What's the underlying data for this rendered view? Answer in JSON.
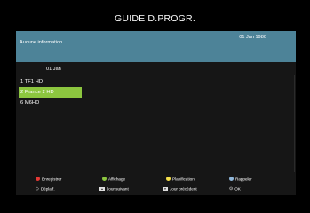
{
  "screen": {
    "title": "GUIDE D.PROGR."
  },
  "info_bar": {
    "message": "Aucune information",
    "date": "01 Jan 1980"
  },
  "guide": {
    "date": "01 Jan",
    "channels": [
      {
        "label": "1 TF1 HD",
        "selected": false
      },
      {
        "label": "2 France 2 HD",
        "selected": true
      },
      {
        "label": "6 M6HD",
        "selected": false
      }
    ]
  },
  "legend": {
    "row1": [
      {
        "label": "Enregistrer",
        "icon": "red-button-icon",
        "color": "#e53935"
      },
      {
        "label": "Affichage",
        "icon": "green-button-icon",
        "color": "#8cc63f"
      },
      {
        "label": "Planification",
        "icon": "yellow-button-icon",
        "color": "#f6e04b"
      },
      {
        "label": "Rappeler",
        "icon": "blue-button-icon",
        "color": "#8fb6d9"
      }
    ],
    "row2": [
      {
        "label": "Déplaff.",
        "icon": "navigation-arrows-icon"
      },
      {
        "label": "Jour suivant",
        "icon": "page-up-key-icon"
      },
      {
        "label": "Jour précédent",
        "icon": "page-down-key-icon"
      },
      {
        "label": "OK",
        "icon": "ok-circle-icon"
      }
    ]
  },
  "colors": {
    "background": "#000000",
    "info_bar": "#4d8398",
    "selection": "#8cc63f"
  }
}
